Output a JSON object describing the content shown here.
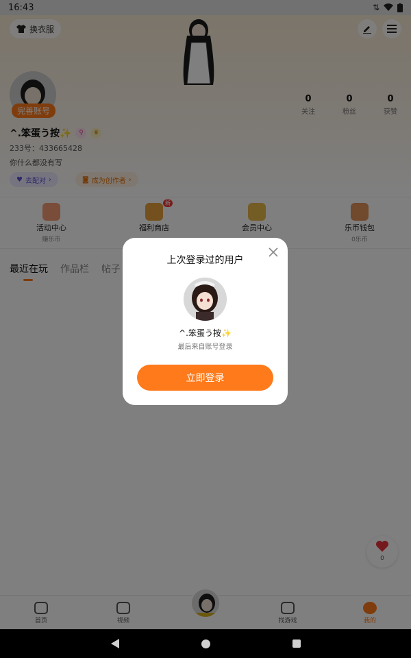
{
  "status_bar": {
    "time": "16:43"
  },
  "header": {
    "outfit_label": "换衣服",
    "edit_icon": "pencil-icon",
    "menu_icon": "hamburger-menu-icon"
  },
  "profile": {
    "complete_badge": "完善账号",
    "username": "^.笨蛋う按✨",
    "uid": "233号：433665428",
    "bio": "你什么都没有写",
    "pill_match": "去配对",
    "pill_creator": "成为创作者",
    "stats": [
      {
        "num": "0",
        "label": "关注"
      },
      {
        "num": "0",
        "label": "粉丝"
      },
      {
        "num": "0",
        "label": "获赞"
      }
    ]
  },
  "quick_entries": [
    {
      "label": "活动中心",
      "sub": "赚乐币",
      "color": "#f29a74"
    },
    {
      "label": "福利商店",
      "sub": "",
      "badge": "新",
      "color": "#e6a03c"
    },
    {
      "label": "会员中心",
      "sub": "",
      "color": "#e8b84a"
    },
    {
      "label": "乐币钱包",
      "sub": "0乐币",
      "color": "#e39258"
    }
  ],
  "tabs": [
    "最近在玩",
    "作品栏",
    "帖子"
  ],
  "like_fab": {
    "count": "0"
  },
  "bottom_nav": [
    {
      "label": "首页",
      "active": false
    },
    {
      "label": "视频",
      "active": false
    },
    {
      "label": "",
      "active": false
    },
    {
      "label": "找游戏",
      "active": false
    },
    {
      "label": "我的",
      "active": true
    }
  ],
  "modal": {
    "title": "上次登录过的用户",
    "username": "^.笨蛋う按✨",
    "sub": "最后来自账号登录",
    "login_button": "立即登录"
  },
  "colors": {
    "accent": "#ff7a1a",
    "overlay": "rgba(0,0,0,0.5)"
  }
}
